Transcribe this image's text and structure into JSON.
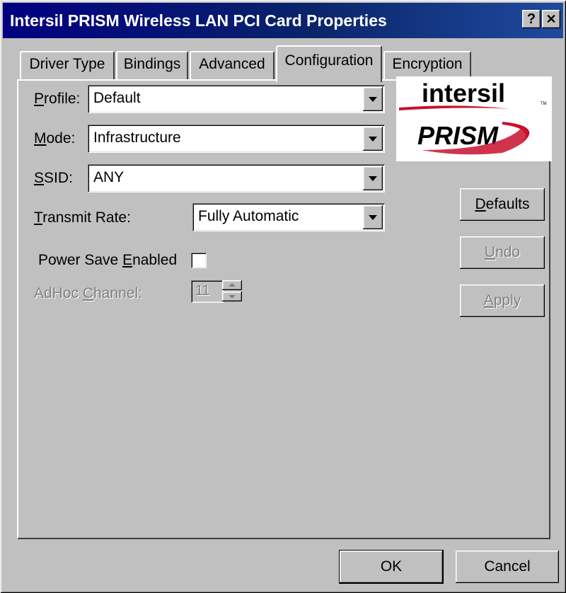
{
  "window": {
    "title": "Intersil PRISM Wireless LAN PCI Card Properties",
    "help_glyph": "?",
    "close_glyph": "✕"
  },
  "tabs": [
    {
      "label": "Driver Type",
      "active": false
    },
    {
      "label": "Bindings",
      "active": false
    },
    {
      "label": "Advanced",
      "active": false
    },
    {
      "label": "Configuration",
      "active": true
    },
    {
      "label": "Encryption",
      "active": false
    }
  ],
  "config": {
    "profile": {
      "label_pre": "",
      "label_u": "P",
      "label_post": "rofile:",
      "value": "Default"
    },
    "mode": {
      "label_pre": "",
      "label_u": "M",
      "label_post": "ode:",
      "value": "Infrastructure"
    },
    "ssid": {
      "label_pre": "",
      "label_u": "S",
      "label_post": "SID:",
      "value": "ANY"
    },
    "transmit_rate": {
      "label_pre": "",
      "label_u": "T",
      "label_post": "ransmit Rate:",
      "value": "Fully Automatic"
    },
    "power_save": {
      "label_pre": "Power Save ",
      "label_u": "E",
      "label_post": "nabled",
      "checked": false
    },
    "adhoc_channel": {
      "label_pre": "AdHoc ",
      "label_u": "C",
      "label_post": "hannel:",
      "value": "11",
      "disabled": true
    }
  },
  "logo": {
    "brand": "intersil",
    "tm": "TM",
    "product": "PRISM",
    "colors": {
      "swoosh": "#c8102e",
      "text": "#000000"
    }
  },
  "side_buttons": {
    "defaults": {
      "label_pre": "",
      "label_u": "D",
      "label_post": "efaults"
    },
    "undo": {
      "label_pre": "",
      "label_u": "U",
      "label_post": "ndo",
      "disabled": true
    },
    "apply": {
      "label_pre": "",
      "label_u": "A",
      "label_post": "pply",
      "disabled": true
    }
  },
  "footer": {
    "ok": "OK",
    "cancel": "Cancel"
  },
  "colors": {
    "titlebar": "#000080",
    "face": "#c0c0c0",
    "disabled_text": "#808080"
  }
}
